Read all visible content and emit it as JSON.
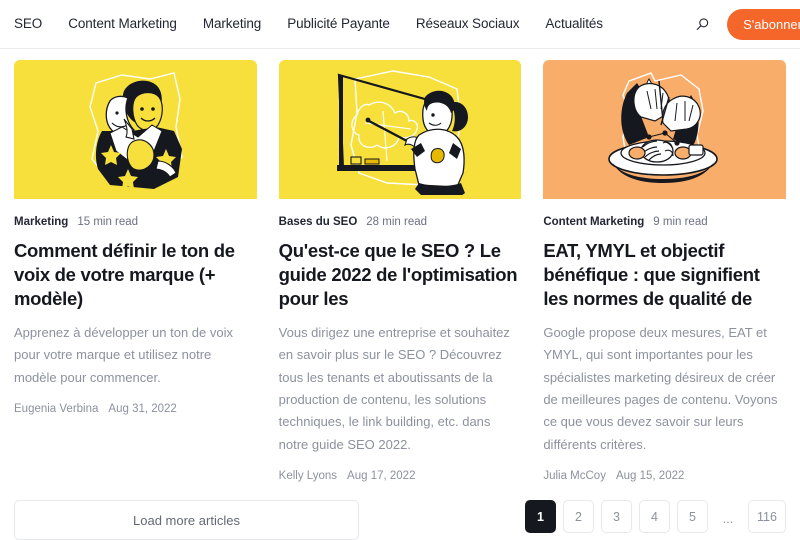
{
  "header": {
    "nav": [
      {
        "label": "SEO"
      },
      {
        "label": "Content Marketing"
      },
      {
        "label": "Marketing"
      },
      {
        "label": "Publicité Payante"
      },
      {
        "label": "Réseaux Sociaux"
      },
      {
        "label": "Actualités"
      }
    ],
    "search_icon": "search-icon",
    "subscribe_label": "S'abonner",
    "accent_color": "#f4662a"
  },
  "cards": [
    {
      "thumb_bg": "#f8e03c",
      "illustration": "person-holding-theater-mask",
      "category": "Marketing",
      "read_time": "15 min read",
      "title": "Comment définir le ton de voix de votre marque (+ modèle)",
      "description": "Apprenez à développer un ton de voix pour votre marque et utilisez notre modèle pour commencer.",
      "author": "Eugenia Verbina",
      "date": "Aug 31, 2022"
    },
    {
      "thumb_bg": "#f8e03c",
      "illustration": "teacher-at-whiteboard-with-pointer",
      "category": "Bases du SEO",
      "read_time": "28 min read",
      "title": "Qu'est-ce que le SEO ? Le guide 2022 de l'optimisation pour les",
      "description": "Vous dirigez une entreprise et souhaitez en savoir plus sur le SEO ? Découvrez tous les tenants et aboutissants de la production de contenu, les solutions techniques, le link building, etc. dans notre guide SEO 2022.",
      "author": "Kelly Lyons",
      "date": "Aug 17, 2022"
    },
    {
      "thumb_bg": "#f9ad6a",
      "illustration": "hands-eating-pasta-plate",
      "category": "Content Marketing",
      "read_time": "9 min read",
      "title": "EAT, YMYL et objectif bénéfique : que signifient les normes de qualité de",
      "description": "Google propose deux mesures, EAT et YMYL, qui sont importantes pour les spécialistes marketing désireux de créer de meilleures pages de contenu. Voyons ce que vous devez savoir sur leurs différents critères.",
      "author": "Julia McCoy",
      "date": "Aug 15, 2022"
    }
  ],
  "footer": {
    "load_more_label": "Load more articles",
    "pagination": [
      {
        "label": "1",
        "active": true
      },
      {
        "label": "2",
        "active": false
      },
      {
        "label": "3",
        "active": false
      },
      {
        "label": "4",
        "active": false
      },
      {
        "label": "5",
        "active": false
      },
      {
        "label": "...",
        "active": false
      },
      {
        "label": "116",
        "active": false
      }
    ]
  }
}
